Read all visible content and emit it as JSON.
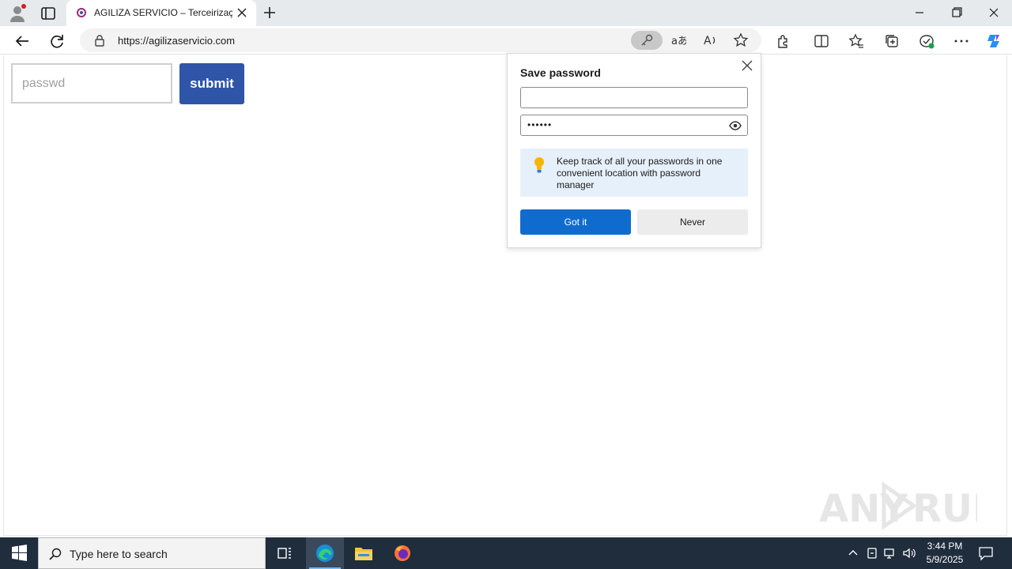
{
  "browser": {
    "tab_title": "AGILIZA SERVICIO – Terceirização",
    "url": "https://agilizaservicio.com"
  },
  "page": {
    "password_placeholder": "passwd",
    "submit_label": "submit"
  },
  "save_password_popup": {
    "title": "Save password",
    "username_value": "",
    "password_dots": "••••••",
    "tip_text": "Keep track of all your passwords in one convenient location with password manager",
    "got_it_label": "Got it",
    "never_label": "Never"
  },
  "watermark": {
    "text": "ANY RUN"
  },
  "taskbar": {
    "search_placeholder": "Type here to search",
    "time": "3:44 PM",
    "date": "5/9/2025"
  },
  "colors": {
    "submit_bg": "#2e55a8",
    "got_it_bg": "#0f6cce",
    "tip_bg": "#e6f0fa",
    "taskbar_bg": "#1f2d3d"
  }
}
